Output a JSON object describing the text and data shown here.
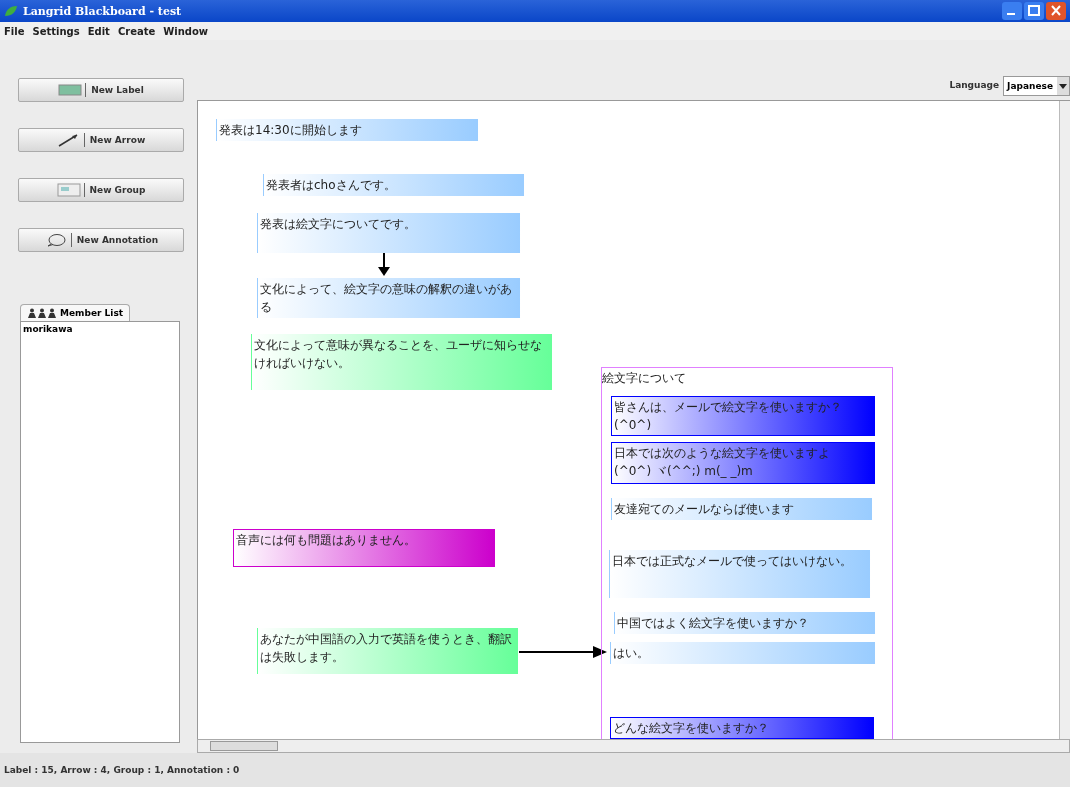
{
  "window": {
    "title": "Langrid Blackboard - test"
  },
  "menu": [
    "File",
    "Settings",
    "Edit",
    "Create",
    "Window"
  ],
  "tools": [
    {
      "kind": "label",
      "label": "New Label"
    },
    {
      "kind": "arrow",
      "label": "New Arrow"
    },
    {
      "kind": "group",
      "label": "New Group"
    },
    {
      "kind": "annotation",
      "label": "New Annotation"
    }
  ],
  "member_panel": {
    "tab": "Member List",
    "members": [
      "morikawa"
    ]
  },
  "language": {
    "label": "Language",
    "value": "Japanese"
  },
  "canvas": {
    "labels": [
      {
        "text": "発表は14:30に開始します",
        "color": "#99ccff"
      },
      {
        "text": "発表者はchoさんです。",
        "color": "#99ccff"
      },
      {
        "text": "発表は絵文字についてです。",
        "color": "#99ccff"
      },
      {
        "text": "文化によって、絵文字の意味の解釈の違いがある",
        "color": "#99ccff"
      },
      {
        "text": "文化によって意味が異なることを、ユーザに知らせなければいけない。",
        "color": "#66ff99"
      },
      {
        "text": "音声には何も問題はありません。",
        "color": "#cc00cc"
      },
      {
        "text": "あなたが中国語の入力で英語を使うとき、翻訳は失敗します。",
        "color": "#66ff99"
      }
    ],
    "group": {
      "title": "絵文字について",
      "labels": [
        {
          "text": "皆さんは、メールで絵文字を使いますか？(^0^)",
          "color": "#0000ff"
        },
        {
          "text": "日本では次のような絵文字を使いますよ　(^0^) ヾ(^^;) m(_ _)m",
          "color": "#0000ff"
        },
        {
          "text": "友達宛てのメールならば使います",
          "color": "#99ccff"
        },
        {
          "text": "日本では正式なメールで使ってはいけない。",
          "color": "#99ccff"
        },
        {
          "text": "中国ではよく絵文字を使いますか？",
          "color": "#99ccff"
        },
        {
          "text": "はい。",
          "color": "#99ccff"
        },
        {
          "text": "どんな絵文字を使いますか？",
          "color": "#0000ff"
        }
      ]
    }
  },
  "status_bar": "Label : 15, Arrow : 4, Group : 1, Annotation : 0"
}
